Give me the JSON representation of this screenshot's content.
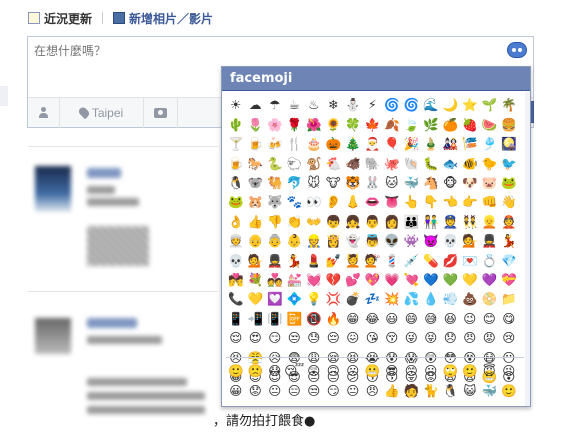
{
  "composer": {
    "tabs": [
      {
        "label": "近況更新",
        "active": true
      },
      {
        "label": "新增相片／影片",
        "active": false
      }
    ],
    "placeholder": "在想什麼嗎？",
    "location": "Taipei"
  },
  "feed": {
    "visible_text": "，請勿拍打餵食●"
  },
  "facemoji": {
    "title": "facemoji",
    "header_color": "#6d84b4",
    "rows": [
      [
        "☀",
        "☁",
        "☂",
        "☕",
        "♨",
        "❄",
        "⛄",
        "⚡",
        "🌀",
        "🌀",
        "🌊",
        "🌙",
        "⭐",
        "🌱",
        "🌴"
      ],
      [
        "🌵",
        "🌷",
        "🌸",
        "🌹",
        "🌺",
        "🌻",
        "🍀",
        "🍁",
        "🍂",
        "🍃",
        "🌿",
        "🍊",
        "🍓",
        "🍉",
        "🍔"
      ],
      [
        "🍸",
        "🍺",
        "🍻",
        "🍴",
        "🎂",
        "🎃",
        "🎄",
        "🎅",
        "🎈",
        "🎉",
        "🎍",
        "🎎",
        "🎏",
        "🎐",
        "🎑"
      ],
      [
        "🍺",
        "🐎",
        "🐍",
        "🐑",
        "🐒",
        "🐔",
        "🐗",
        "🐘",
        "🐙",
        "🐚",
        "🐛",
        "🐟",
        "🐠",
        "🐤",
        "🐦"
      ],
      [
        "🐧",
        "🐨",
        "🐫",
        "🐬",
        "🐭",
        "🐮",
        "🐯",
        "🐰",
        "🐱",
        "🐳",
        "🐴",
        "🐵",
        "🐶",
        "🐷",
        "🐸"
      ],
      [
        "🐸",
        "🐹",
        "🐺",
        "🐾",
        "👀",
        "👂",
        "👃",
        "👄",
        "👅",
        "👆",
        "👇",
        "👈",
        "👉",
        "👊",
        "👋"
      ],
      [
        "👌",
        "👍",
        "👎",
        "👏",
        "👐",
        "👦",
        "👧",
        "👨",
        "👩",
        "👪",
        "👫",
        "👮",
        "👯",
        "👱",
        "👲"
      ],
      [
        "👳",
        "👴",
        "👵",
        "👶",
        "👷",
        "👸",
        "👻",
        "👼",
        "👽",
        "👾",
        "👿",
        "💀",
        "💁",
        "💂",
        "💃"
      ],
      [
        "💀",
        "💁",
        "💂",
        "💃",
        "💄",
        "💅",
        "💆",
        "💇",
        "💈",
        "💉",
        "💊",
        "💋",
        "💌",
        "💍",
        "💎"
      ],
      [
        "💏",
        "💐",
        "💑",
        "💒",
        "💓",
        "💔",
        "💕",
        "💖",
        "💗",
        "💘",
        "💙",
        "💚",
        "💛",
        "💜",
        "💝"
      ],
      [
        "📞",
        "💛",
        "💟",
        "💠",
        "💡",
        "💢",
        "💣",
        "💤",
        "💥",
        "💦",
        "💧",
        "💨",
        "💩",
        "📀",
        "📁"
      ],
      [
        "📱",
        "📲",
        "📳",
        "📴",
        "📵",
        "🔥",
        "😁",
        "😂",
        "😃",
        "😄",
        "😅",
        "😆",
        "😉",
        "😊",
        "😋"
      ],
      [
        "😌",
        "😍",
        "😏",
        "😒",
        "😓",
        "😔",
        "😖",
        "😘",
        "😚",
        "😜",
        "😝",
        "😞",
        "😠",
        "😡",
        "😢"
      ],
      [
        "😣",
        "😤",
        "😥",
        "😨",
        "😩",
        "😪",
        "😫",
        "😭",
        "😰",
        "😱",
        "😲",
        "😳",
        "😵",
        "😷",
        "😶"
      ],
      [
        "😀",
        "😇",
        "😈",
        "😎",
        "😐",
        "😑",
        "😕",
        "😗",
        "😙",
        "😛",
        "😟",
        "😦",
        "😧",
        "😬",
        "😮"
      ]
    ],
    "recent_rows": [
      [
        "🙂",
        "🙁",
        "😯",
        "😴",
        "😲",
        "🙃",
        "😗",
        "😬",
        "😎",
        "😙",
        "😐",
        "🙄",
        "🙂",
        "😇",
        "😉"
      ],
      [
        "😀",
        "😟",
        "😐",
        "😑",
        "😒",
        "😏",
        "😐",
        "😠",
        "👍",
        "🧑",
        "🐈",
        "🐧",
        "😺",
        "🐳",
        "🙂"
      ]
    ]
  }
}
